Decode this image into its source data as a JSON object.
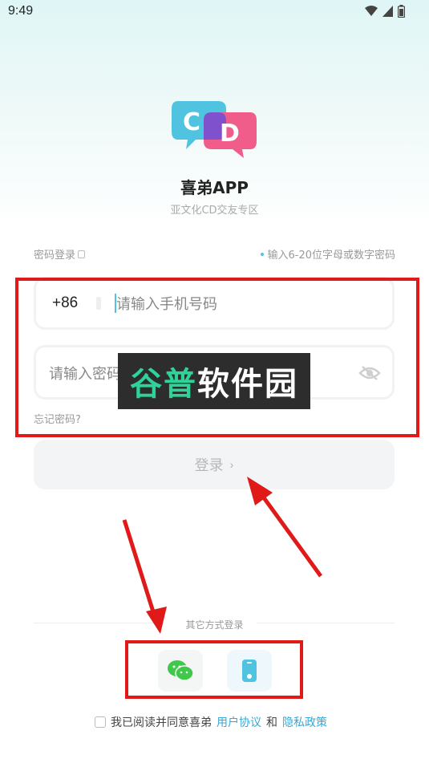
{
  "status_bar": {
    "time": "9:49"
  },
  "app": {
    "name": "喜弟APP",
    "tagline": "亚文化CD交友专区"
  },
  "login_form": {
    "mode_label": "密码登录",
    "hint": "输入6-20位字母或数字密码",
    "country_code": "+86",
    "phone_placeholder": "请输入手机号码",
    "password_placeholder": "请输入密码",
    "forgot_label": "忘记密码?",
    "login_label": "登录",
    "login_chevron": "›"
  },
  "other_login": {
    "label": "其它方式登录"
  },
  "agreement": {
    "prefix": "我已阅读并同意喜弟",
    "user_agreement": "用户协议",
    "and": "和",
    "privacy_policy": "隐私政策"
  },
  "watermark": {
    "part1": "谷普",
    "part2": "软件园"
  },
  "colors": {
    "accent": "#35a9d6",
    "annotation_red": "#e01919",
    "logo_blue": "#4fc3e0",
    "logo_pink": "#f05d8a"
  },
  "icons": [
    "wifi-icon",
    "signal-icon",
    "battery-icon",
    "eye-off-icon",
    "wechat-icon",
    "phone-icon",
    "checkbox-icon",
    "mode-switch-icon"
  ]
}
